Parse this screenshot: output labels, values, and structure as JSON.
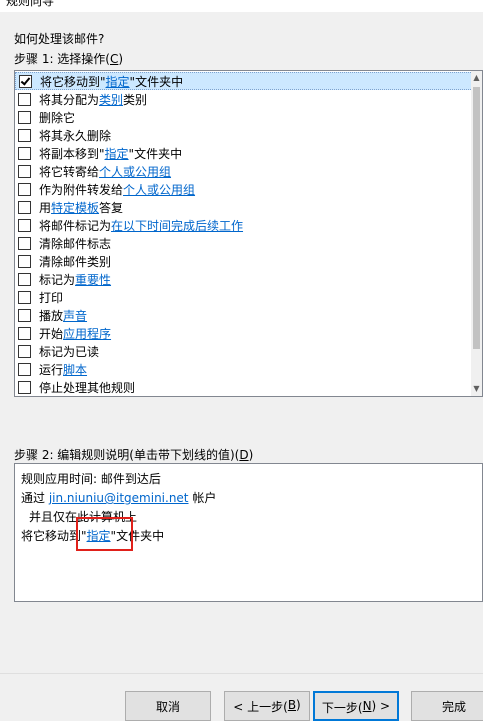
{
  "window": {
    "title": "规则向导"
  },
  "question": "如何处理该邮件?",
  "step1": {
    "text": "步骤 1: 选择操作(",
    "key": "C",
    "close": ")"
  },
  "actions": [
    {
      "checked": true,
      "selected": true,
      "pre": "将它移动到\"",
      "link": "指定",
      "post": "\"文件夹中"
    },
    {
      "checked": false,
      "selected": false,
      "pre": "将其分配为 ",
      "link": "类别",
      "post": " 类别"
    },
    {
      "checked": false,
      "selected": false,
      "pre": "删除它",
      "link": "",
      "post": ""
    },
    {
      "checked": false,
      "selected": false,
      "pre": "将其永久删除",
      "link": "",
      "post": ""
    },
    {
      "checked": false,
      "selected": false,
      "pre": "将副本移到\"",
      "link": "指定",
      "post": "\"文件夹中"
    },
    {
      "checked": false,
      "selected": false,
      "pre": "将它转寄给 ",
      "link": "个人或公用组",
      "post": ""
    },
    {
      "checked": false,
      "selected": false,
      "pre": "作为附件转发给 ",
      "link": "个人或公用组",
      "post": ""
    },
    {
      "checked": false,
      "selected": false,
      "pre": "用 ",
      "link": "特定模板",
      "post": " 答复"
    },
    {
      "checked": false,
      "selected": false,
      "pre": "将邮件标记为 ",
      "link": "在以下时间完成后续工作",
      "post": ""
    },
    {
      "checked": false,
      "selected": false,
      "pre": "清除邮件标志",
      "link": "",
      "post": ""
    },
    {
      "checked": false,
      "selected": false,
      "pre": "清除邮件类别",
      "link": "",
      "post": ""
    },
    {
      "checked": false,
      "selected": false,
      "pre": "标记为 ",
      "link": "重要性",
      "post": ""
    },
    {
      "checked": false,
      "selected": false,
      "pre": "打印",
      "link": "",
      "post": ""
    },
    {
      "checked": false,
      "selected": false,
      "pre": "播放 ",
      "link": "声音",
      "post": ""
    },
    {
      "checked": false,
      "selected": false,
      "pre": "开始 ",
      "link": "应用程序",
      "post": ""
    },
    {
      "checked": false,
      "selected": false,
      "pre": "标记为已读",
      "link": "",
      "post": ""
    },
    {
      "checked": false,
      "selected": false,
      "pre": "运行 ",
      "link": "脚本",
      "post": ""
    },
    {
      "checked": false,
      "selected": false,
      "pre": "停止处理其他规则",
      "link": "",
      "post": ""
    }
  ],
  "step2": {
    "text": "步骤 2: 编辑规则说明(单击带下划线的值)(",
    "key": "D",
    "close": ")"
  },
  "description": {
    "line1": "规则应用时间: 邮件到达后",
    "line2_pre": "通过 ",
    "line2_link": "jin.niuniu@itgemini.net",
    "line2_post": " 帐户",
    "line3": "并且仅在此计算机上",
    "line4_pre": "将它移动到\"",
    "line4_link": "指定",
    "line4_post": "\"文件夹中"
  },
  "buttons": {
    "cancel": "取消",
    "back_pre": "< 上一步(",
    "back_key": "B",
    "back_post": ")",
    "next_pre": "下一步(",
    "next_key": "N",
    "next_post": ") >",
    "finish": "完成"
  },
  "colors": {
    "selection": "#cce8ff",
    "link": "#0066cc",
    "focus": "#0078d7",
    "annotation": "#e0201a"
  }
}
